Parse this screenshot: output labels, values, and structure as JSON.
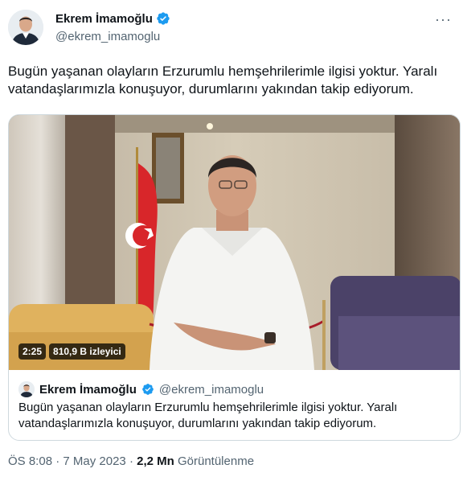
{
  "author": {
    "name": "Ekrem İmamoğlu",
    "handle": "@ekrem_imamoglu"
  },
  "tweet": {
    "text": "Bugün yaşanan olayların Erzurumlu hemşehrilerimle ilgisi yoktur. Yaralı vatandaşlarımızla konuşuyor, durumlarını yakından takip ediyorum."
  },
  "video": {
    "duration": "2:25",
    "views": "810,9 B izleyici"
  },
  "quote": {
    "name": "Ekrem İmamoğlu",
    "handle": "@ekrem_imamoglu",
    "text": "Bugün yaşanan olayların Erzurumlu hemşehrilerimle ilgisi yoktur. Yaralı vatandaşlarımızla konuşuyor, durumlarını yakından takip ediyorum."
  },
  "meta": {
    "time": "ÖS 8:08",
    "separator": "·",
    "date": "7 May 2023",
    "views_count": "2,2 Mn",
    "views_label": "Görüntülenme"
  },
  "colors": {
    "verified": "#1d9bf0",
    "secondary_text": "#536471",
    "border": "#cfd9de"
  }
}
